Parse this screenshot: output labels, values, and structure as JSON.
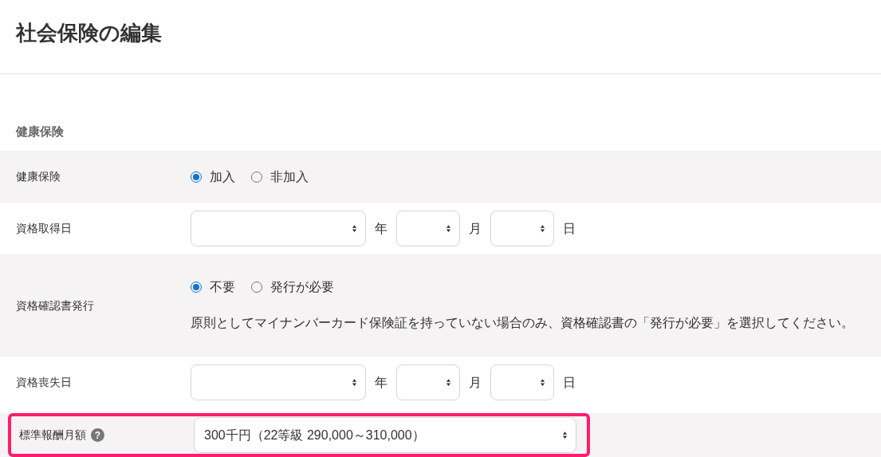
{
  "page_title": "社会保険の編集",
  "section_title": "健康保険",
  "rows": [
    {
      "kind": "radio",
      "label": "健康保険",
      "options": [
        {
          "label": "加入",
          "selected": true
        },
        {
          "label": "非加入",
          "selected": false
        }
      ]
    },
    {
      "kind": "date",
      "label": "資格取得日",
      "units": [
        "年",
        "月",
        "日"
      ]
    },
    {
      "kind": "radio",
      "label": "資格確認書発行",
      "options": [
        {
          "label": "不要",
          "selected": true
        },
        {
          "label": "発行が必要",
          "selected": false
        }
      ],
      "note": "原則としてマイナンバーカード保険証を持っていない場合のみ、資格確認書の「発行が必要」を選択してください。"
    },
    {
      "kind": "date",
      "label": "資格喪失日",
      "units": [
        "年",
        "月",
        "日"
      ]
    },
    {
      "kind": "select",
      "label": "標準報酬月額",
      "help_mark": "?",
      "value": "300千円（22等級 290,000～310,000）",
      "highlighted": true
    }
  ]
}
